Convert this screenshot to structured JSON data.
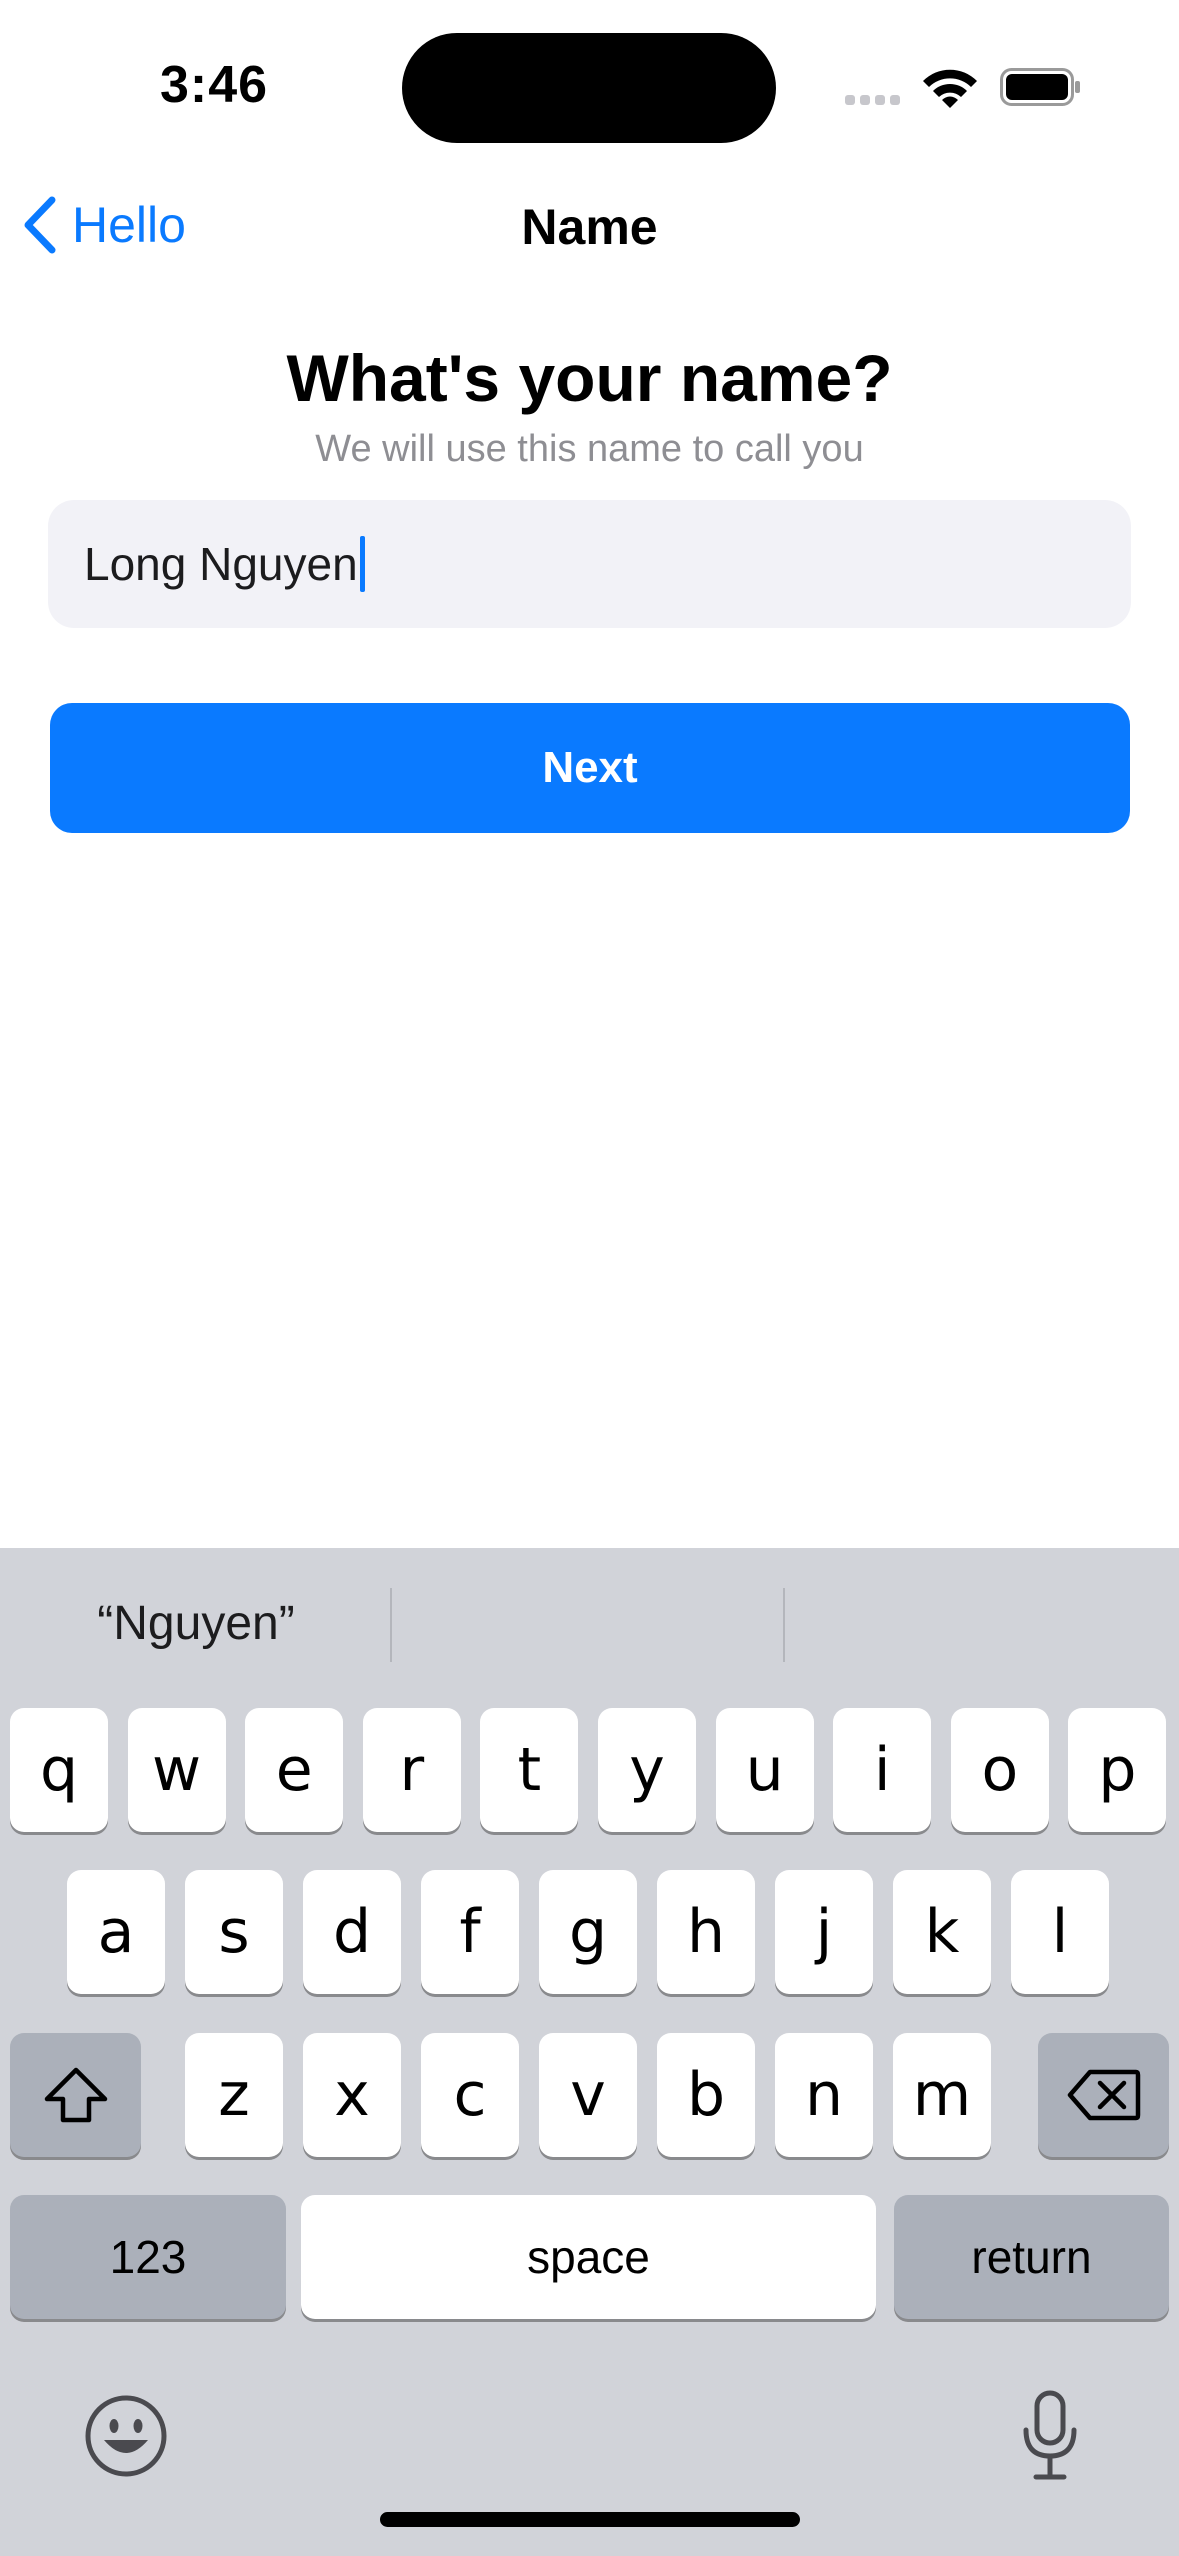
{
  "status_bar": {
    "time": "3:46"
  },
  "nav": {
    "back_label": "Hello",
    "title": "Name"
  },
  "content": {
    "heading": "What's your name?",
    "subtitle": "We will use this name to call you",
    "name_value": "Long Nguyen",
    "next_label": "Next"
  },
  "keyboard": {
    "suggestion": "“Nguyen”",
    "row1": [
      "q",
      "w",
      "e",
      "r",
      "t",
      "y",
      "u",
      "i",
      "o",
      "p"
    ],
    "row2": [
      "a",
      "s",
      "d",
      "f",
      "g",
      "h",
      "j",
      "k",
      "l"
    ],
    "row3": [
      "z",
      "x",
      "c",
      "v",
      "b",
      "n",
      "m"
    ],
    "numbers_label": "123",
    "space_label": "space",
    "return_label": "return",
    "icons": [
      "shift-icon",
      "backspace-icon",
      "emoji-icon",
      "microphone-icon"
    ]
  },
  "colors": {
    "accent": "#0a7aff",
    "field_bg": "#f2f2f7",
    "keyboard_bg": "#d1d3d9"
  }
}
